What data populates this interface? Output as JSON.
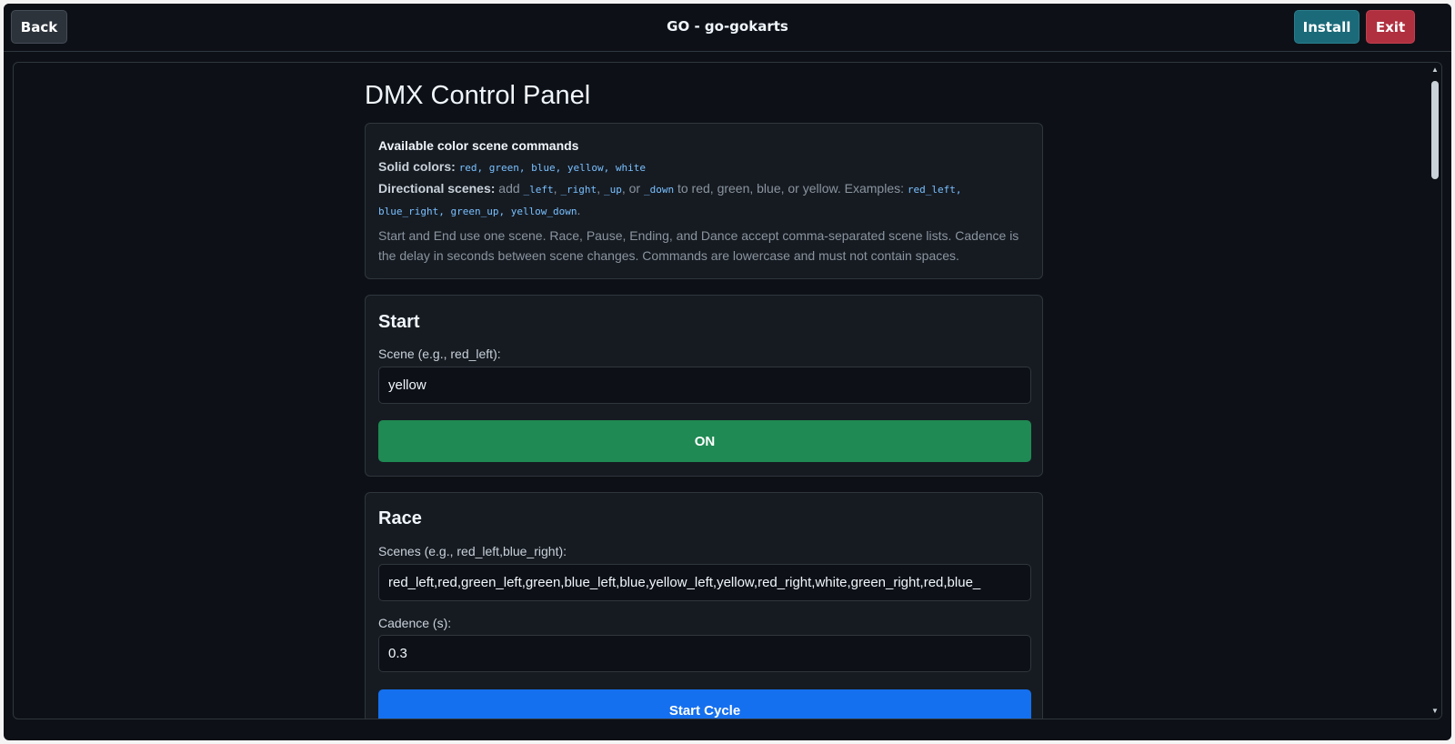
{
  "header": {
    "back_label": "Back",
    "title": "GO - go-gokarts",
    "install_label": "Install",
    "exit_label": "Exit"
  },
  "page": {
    "title": "DMX Control Panel"
  },
  "info": {
    "title": "Available color scene commands",
    "solid_label": "Solid colors:",
    "solid_codes": "red, green, blue, yellow, white",
    "directional_label": "Directional scenes:",
    "directional_add": "add",
    "suffix_left": "_left",
    "comma1": ",",
    "suffix_right": "_right",
    "comma2": ",",
    "suffix_up": "_up",
    "or_text": ", or",
    "suffix_down": "_down",
    "directional_rest": "to red, green, blue, or yellow. Examples:",
    "example1": "red_left,",
    "examples_rest": "blue_right, green_up, yellow_down",
    "period": ".",
    "paragraph": "Start and End use one scene. Race, Pause, Ending, and Dance accept comma-separated scene lists. Cadence is the delay in seconds between scene changes. Commands are lowercase and must not contain spaces."
  },
  "start": {
    "heading": "Start",
    "scene_label": "Scene (e.g., red_left):",
    "scene_value": "yellow",
    "on_label": "ON"
  },
  "race": {
    "heading": "Race",
    "scenes_label": "Scenes (e.g., red_left,blue_right):",
    "scenes_value": "red_left,red,green_left,green,blue_left,blue,yellow_left,yellow,red_right,white,green_right,red,blue_",
    "cadence_label": "Cadence (s):",
    "cadence_value": "0.3",
    "start_cycle_label": "Start Cycle"
  },
  "icons": {
    "scroll_up": "scroll-up-arrow-icon",
    "scroll_down": "scroll-down-arrow-icon"
  },
  "colors": {
    "background": "#0d1117",
    "card": "#161b22",
    "on_button": "#1f8a53",
    "cycle_button": "#1570ef",
    "install_button": "#1b6a7a",
    "exit_button": "#b0303f",
    "code": "#79c0ff"
  }
}
